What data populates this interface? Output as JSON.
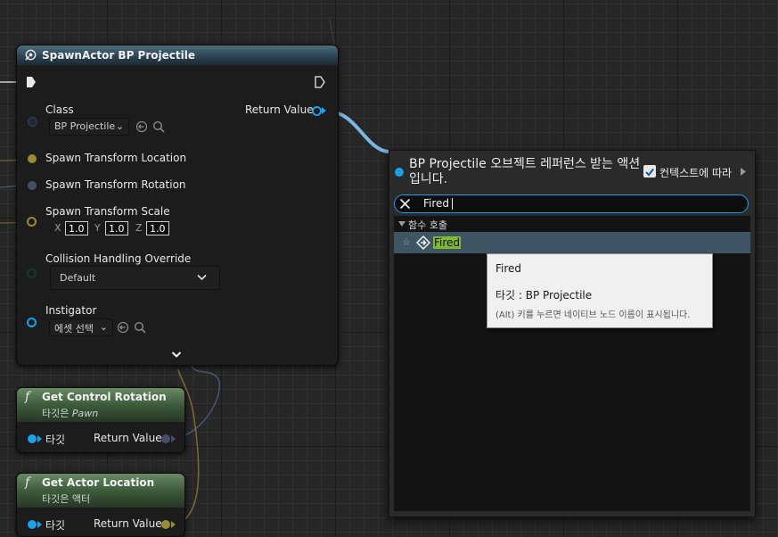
{
  "spawn_node": {
    "title": "SpawnActor BP Projectile",
    "class_label": "Class",
    "class_value": "BP Projectile",
    "return_value_label": "Return Value",
    "pins": {
      "location": "Spawn Transform Location",
      "rotation": "Spawn Transform Rotation",
      "scale": "Spawn Transform Scale",
      "collision": "Collision Handling Override",
      "instigator": "Instigator"
    },
    "scale": {
      "x_label": "X",
      "x": "1.0",
      "y_label": "Y",
      "y": "1.0",
      "z_label": "Z",
      "z": "1.0"
    },
    "collision_value": "Default",
    "instigator_value": "에셋 선택"
  },
  "func_nodes": [
    {
      "title": "Get Control Rotation",
      "subtitle_prefix": "타깃은 ",
      "subtitle_em": "Pawn",
      "target_label": "타깃",
      "return_label": "Return Value"
    },
    {
      "title": "Get Actor Location",
      "subtitle": "타깃은 액터",
      "target_label": "타깃",
      "return_label": "Return Value"
    }
  ],
  "action_menu": {
    "title": "BP Projectile 오브젝트 레퍼런스 받는 액션입니다.",
    "context_label": "컨텍스트에 따라",
    "context_checked": true,
    "search_value": "Fired",
    "category": "함수 호출",
    "item_label": "Fired"
  },
  "tooltip": {
    "title": "Fired",
    "target": "타깃 : BP Projectile",
    "hint": "(Alt) 키를 누르면 네이티브 노드 이름이 표시됩니다."
  },
  "colors": {
    "object_pin": "#17a2ec",
    "vector_pin": "#b8a13a",
    "rotator_pin": "#8e97d8",
    "highlight": "#7fba2e",
    "selected_row": "#3f5563"
  }
}
